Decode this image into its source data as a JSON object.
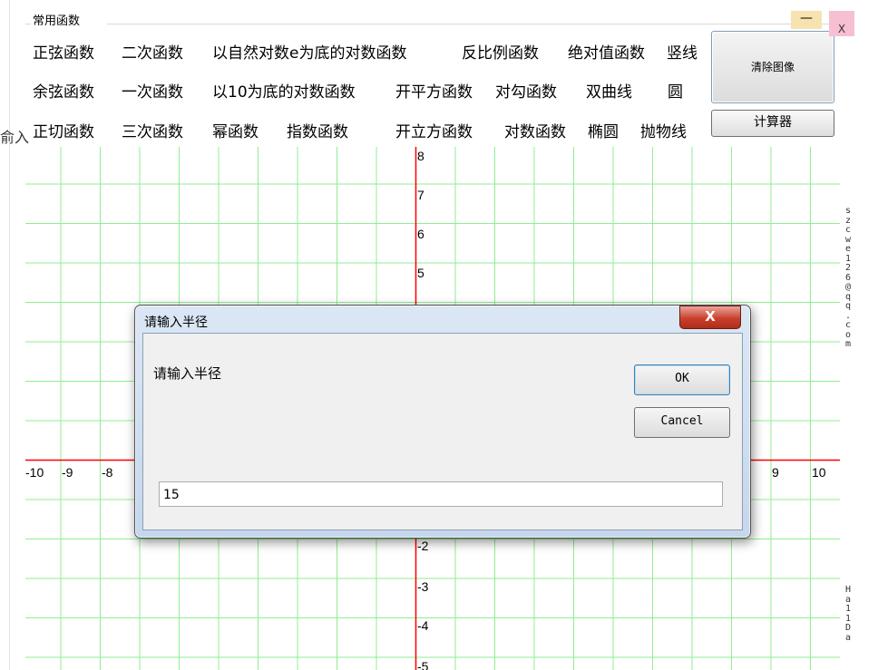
{
  "group_title": "常用函数",
  "menu": {
    "row1": [
      "正弦函数",
      "二次函数",
      "以自然对数e为底的对数函数",
      "反比例函数",
      "绝对值函数",
      "竖线"
    ],
    "row2": [
      "余弦函数",
      "一次函数",
      "以10为底的对数函数",
      "开平方函数",
      "对勾函数",
      "双曲线",
      "圆"
    ],
    "row3": [
      "正切函数",
      "三次函数",
      "幂函数",
      "指数函数",
      "开立方函数",
      "对数函数",
      "椭圆",
      "抛物线"
    ]
  },
  "buttons": {
    "clear": "清除图像",
    "calculator": "计算器"
  },
  "window_controls": {
    "minimize": "—",
    "close": "X"
  },
  "cut_text": "俞入",
  "sidebar": {
    "top_text": "szcwe126@qq.com",
    "bottom_text": "Ha11Da"
  },
  "axis_labels": {
    "x": [
      "-10",
      "-9",
      "-8",
      "9",
      "10"
    ],
    "y_positive": [
      "8",
      "7",
      "6",
      "5"
    ],
    "y_negative": [
      "-2",
      "-3",
      "-4",
      "-5"
    ]
  },
  "dialog": {
    "title": "请输入半径",
    "prompt": "请输入半径",
    "ok": "OK",
    "cancel": "Cancel",
    "input_value": "15",
    "close_glyph": "X"
  },
  "colors": {
    "grid": "#90ee90",
    "axis": "#ff0000",
    "dialog_frame": "#c5d7ec",
    "close_button": "#c9412e"
  }
}
